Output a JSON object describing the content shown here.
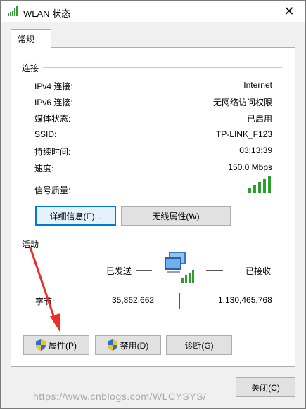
{
  "window": {
    "title": "WLAN 状态"
  },
  "tabs": [
    {
      "label": "常规"
    }
  ],
  "connection": {
    "group_label": "连接",
    "rows": [
      {
        "label": "IPv4 连接:",
        "value": "Internet"
      },
      {
        "label": "IPv6 连接:",
        "value": "无网络访问权限"
      },
      {
        "label": "媒体状态:",
        "value": "已启用"
      },
      {
        "label": "SSID:",
        "value": "TP-LINK_F123"
      },
      {
        "label": "持续时间:",
        "value": "03:13:39"
      },
      {
        "label": "速度:",
        "value": "150.0 Mbps"
      }
    ],
    "signal_label": "信号质量:",
    "signal_bars": 5,
    "details_button": "详细信息(E)...",
    "wireless_props_button": "无线属性(W)"
  },
  "activity": {
    "group_label": "活动",
    "sent_label": "已发送",
    "received_label": "已接收",
    "bytes_label": "字节:",
    "bytes_sent": "35,862,662",
    "bytes_received": "1,130,465,768",
    "properties_button": "属性(P)",
    "disable_button": "禁用(D)",
    "diagnose_button": "诊断(G)"
  },
  "close_button": "关闭(C)",
  "watermark": "https://www.cnblogs.com/WLCYSYS/",
  "colors": {
    "accent": "#0078d7",
    "signal": "#2e9e2e",
    "arrow": "#e8302a"
  }
}
